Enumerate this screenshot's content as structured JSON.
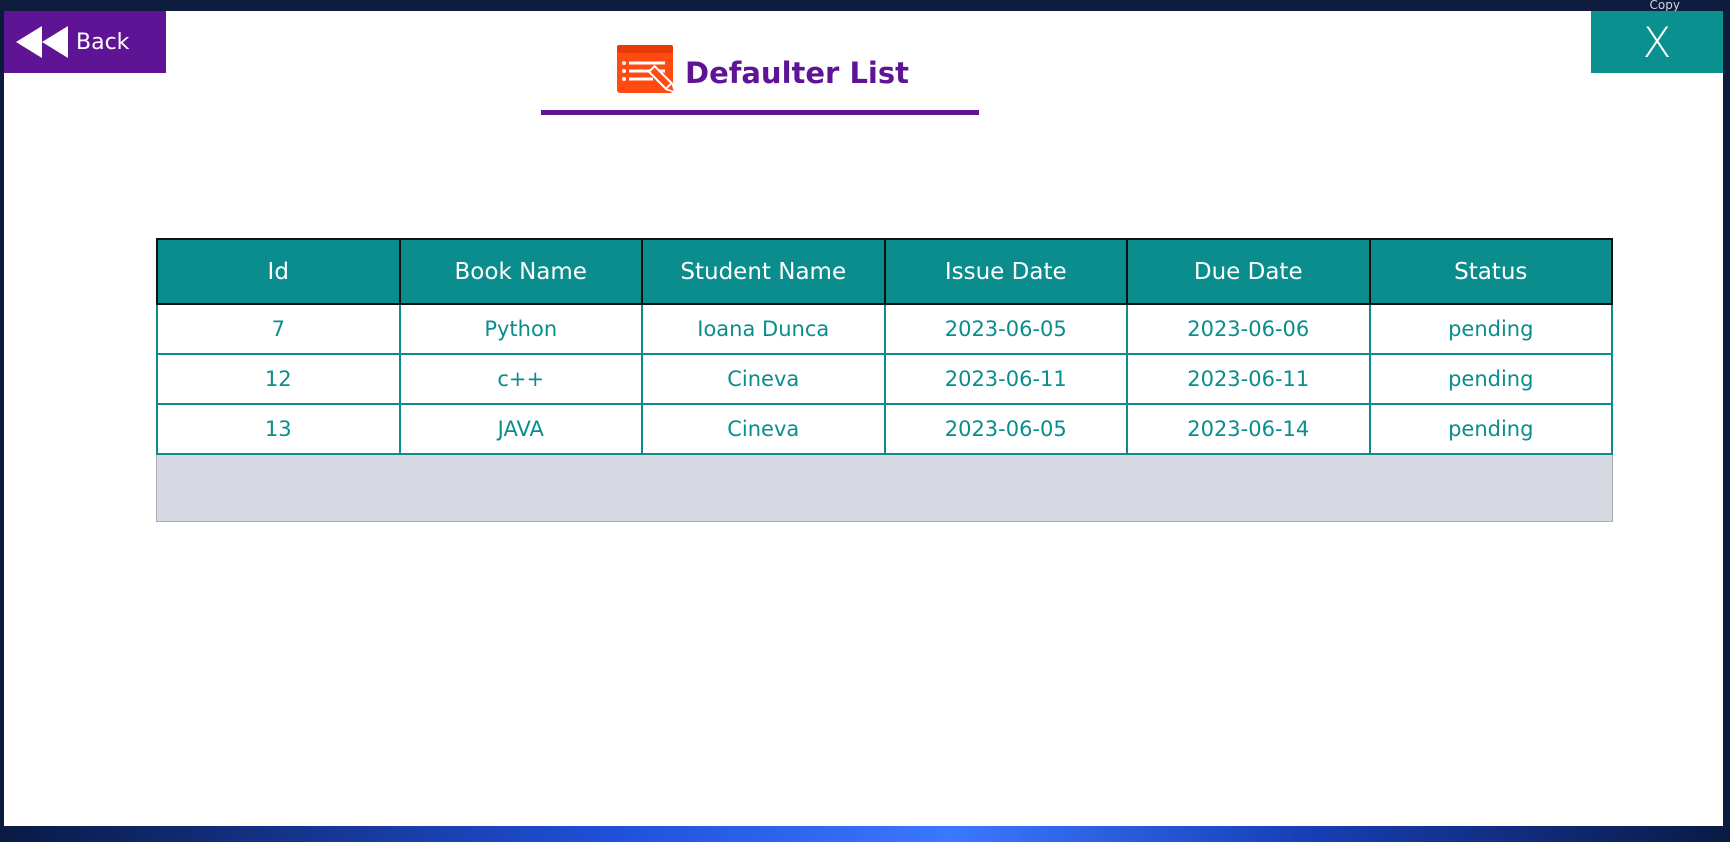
{
  "window": {
    "back_label": "Back",
    "close_label": "X",
    "title": "Defaulter List"
  },
  "desktop": {
    "corner_text": "Copy"
  },
  "table": {
    "columns": [
      "Id",
      "Book Name",
      "Student Name",
      "Issue Date",
      "Due Date",
      "Status"
    ],
    "rows": [
      [
        "7",
        "Python",
        "Ioana Dunca",
        "2023-06-05",
        "2023-06-06",
        "pending"
      ],
      [
        "12",
        "c++",
        "Cineva",
        "2023-06-11",
        "2023-06-11",
        "pending"
      ],
      [
        "13",
        "JAVA",
        "Cineva",
        "2023-06-05",
        "2023-06-14",
        "pending"
      ]
    ]
  },
  "colors": {
    "accent_purple": "#5e1495",
    "teal": "#0b8d8d",
    "icon_orange": "#ff4a12",
    "grid_background": "#d6d9e1"
  },
  "icons": {
    "back": "rewind-icon",
    "title": "list-edit-icon",
    "close": "close-icon"
  }
}
